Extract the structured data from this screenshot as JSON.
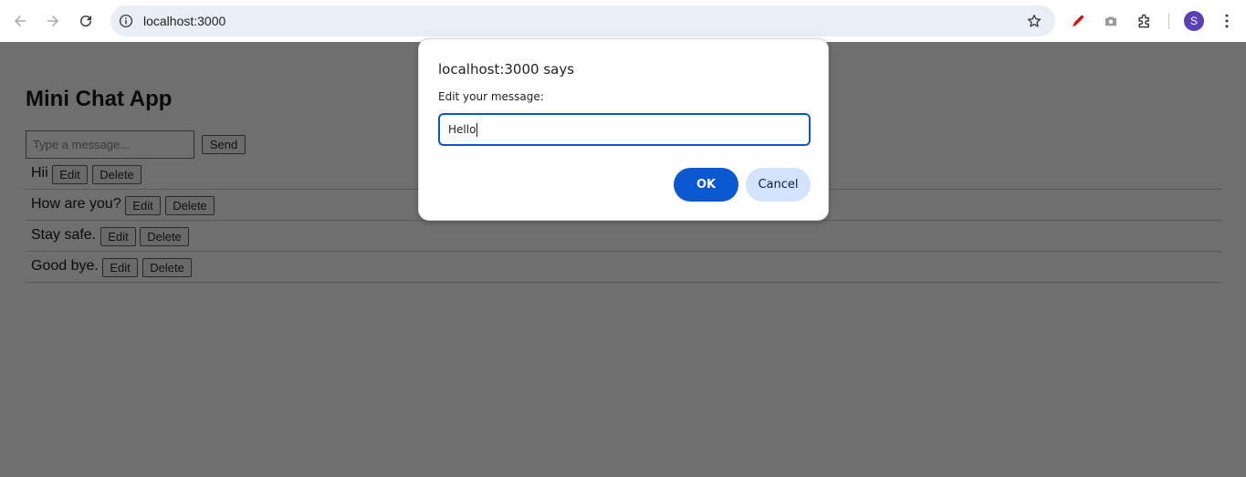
{
  "browser": {
    "url": "localhost:3000",
    "avatar_initial": "S"
  },
  "app": {
    "title": "Mini Chat App",
    "input_placeholder": "Type a message...",
    "send_label": "Send",
    "edit_label": "Edit",
    "delete_label": "Delete",
    "messages": [
      {
        "text": "Hii"
      },
      {
        "text": "How are you?"
      },
      {
        "text": "Stay safe."
      },
      {
        "text": "Good bye."
      }
    ]
  },
  "dialog": {
    "title": "localhost:3000 says",
    "prompt": "Edit your message:",
    "input_value": "Hello",
    "ok_label": "OK",
    "cancel_label": "Cancel"
  },
  "colors": {
    "overlay_page": "#6f6f6f",
    "accent": "#0b57d0",
    "cancel_bg": "#d3e3fd",
    "avatar": "#5b3fb5"
  }
}
